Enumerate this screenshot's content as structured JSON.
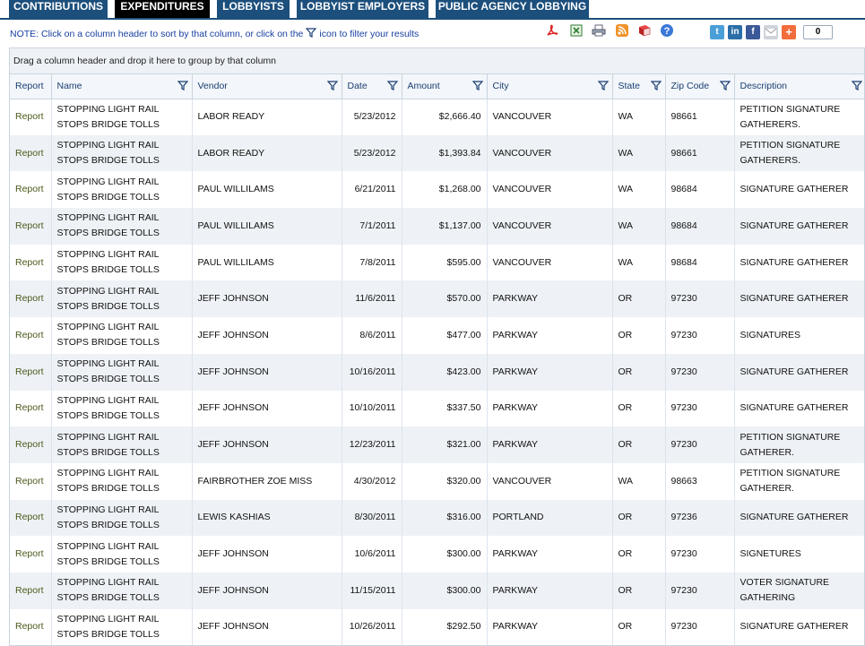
{
  "tabs": [
    {
      "label": "CONTRIBUTIONS",
      "active": false
    },
    {
      "label": "EXPENDITURES",
      "active": true
    },
    {
      "label": "LOBBYISTS",
      "active": false
    },
    {
      "label": "LOBBYIST EMPLOYERS",
      "active": false
    },
    {
      "label": "PUBLIC AGENCY LOBBYING",
      "active": false
    }
  ],
  "note": {
    "before": "NOTE: Click on a column header to sort by that column, or click on the",
    "after": "icon to filter your results"
  },
  "export_icons": [
    "pdf-icon",
    "excel-icon",
    "print-icon",
    "rss-icon",
    "book-icon",
    "help-icon"
  ],
  "share_icons": [
    "twitter-icon",
    "linkedin-icon",
    "facebook-icon",
    "email-icon",
    "addthis-icon"
  ],
  "share_count": "0",
  "group_panel": "Drag a column header and drop it here to group by that column",
  "columns": [
    "Report",
    "Name",
    "Vendor",
    "Date",
    "Amount",
    "City",
    "State",
    "Zip Code",
    "Description"
  ],
  "rows": [
    [
      "Report",
      "STOPPING LIGHT RAIL STOPS BRIDGE TOLLS",
      "LABOR READY",
      "5/23/2012",
      "$2,666.40",
      "VANCOUVER",
      "WA",
      "98661",
      "PETITION SIGNATURE GATHERERS."
    ],
    [
      "Report",
      "STOPPING LIGHT RAIL STOPS BRIDGE TOLLS",
      "LABOR READY",
      "5/23/2012",
      "$1,393.84",
      "VANCOUVER",
      "WA",
      "98661",
      "PETITION SIGNATURE GATHERERS."
    ],
    [
      "Report",
      "STOPPING LIGHT RAIL STOPS BRIDGE TOLLS",
      "PAUL WILLILAMS",
      "6/21/2011",
      "$1,268.00",
      "VANCOUVER",
      "WA",
      "98684",
      "SIGNATURE GATHERER"
    ],
    [
      "Report",
      "STOPPING LIGHT RAIL STOPS BRIDGE TOLLS",
      "PAUL WILLILAMS",
      "7/1/2011",
      "$1,137.00",
      "VANCOUVER",
      "WA",
      "98684",
      "SIGNATURE GATHERER"
    ],
    [
      "Report",
      "STOPPING LIGHT RAIL STOPS BRIDGE TOLLS",
      "PAUL WILLILAMS",
      "7/8/2011",
      "$595.00",
      "VANCOUVER",
      "WA",
      "98684",
      "SIGNATURE GATHERER"
    ],
    [
      "Report",
      "STOPPING LIGHT RAIL STOPS BRIDGE TOLLS",
      "JEFF JOHNSON",
      "11/6/2011",
      "$570.00",
      "PARKWAY",
      "OR",
      "97230",
      "SIGNATURE GATHERER"
    ],
    [
      "Report",
      "STOPPING LIGHT RAIL STOPS BRIDGE TOLLS",
      "JEFF JOHNSON",
      "8/6/2011",
      "$477.00",
      "PARKWAY",
      "OR",
      "97230",
      "SIGNATURES"
    ],
    [
      "Report",
      "STOPPING LIGHT RAIL STOPS BRIDGE TOLLS",
      "JEFF JOHNSON",
      "10/16/2011",
      "$423.00",
      "PARKWAY",
      "OR",
      "97230",
      "SIGNATURE GATHERER"
    ],
    [
      "Report",
      "STOPPING LIGHT RAIL STOPS BRIDGE TOLLS",
      "JEFF JOHNSON",
      "10/10/2011",
      "$337.50",
      "PARKWAY",
      "OR",
      "97230",
      "SIGNATURE GATHERER"
    ],
    [
      "Report",
      "STOPPING LIGHT RAIL STOPS BRIDGE TOLLS",
      "JEFF JOHNSON",
      "12/23/2011",
      "$321.00",
      "PARKWAY",
      "OR",
      "97230",
      "PETITION SIGNATURE GATHERER."
    ],
    [
      "Report",
      "STOPPING LIGHT RAIL STOPS BRIDGE TOLLS",
      "FAIRBROTHER ZOE MISS",
      "4/30/2012",
      "$320.00",
      "VANCOUVER",
      "WA",
      "98663",
      "PETITION SIGNATURE GATHERER."
    ],
    [
      "Report",
      "STOPPING LIGHT RAIL STOPS BRIDGE TOLLS",
      "LEWIS KASHIAS",
      "8/30/2011",
      "$316.00",
      "PORTLAND",
      "OR",
      "97236",
      "SIGNATURE GATHERER"
    ],
    [
      "Report",
      "STOPPING LIGHT RAIL STOPS BRIDGE TOLLS",
      "JEFF JOHNSON",
      "10/6/2011",
      "$300.00",
      "PARKWAY",
      "OR",
      "97230",
      "SIGNETURES"
    ],
    [
      "Report",
      "STOPPING LIGHT RAIL STOPS BRIDGE TOLLS",
      "JEFF JOHNSON",
      "11/15/2011",
      "$300.00",
      "PARKWAY",
      "OR",
      "97230",
      "VOTER SIGNATURE GATHERING"
    ],
    [
      "Report",
      "STOPPING LIGHT RAIL STOPS BRIDGE TOLLS",
      "JEFF JOHNSON",
      "10/26/2011",
      "$292.50",
      "PARKWAY",
      "OR",
      "97230",
      "SIGNATURE GATHERER"
    ]
  ]
}
